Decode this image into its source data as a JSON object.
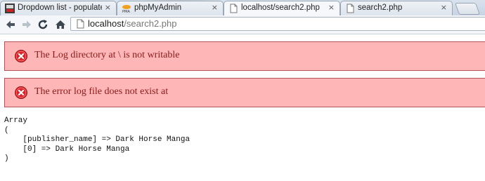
{
  "tabs": [
    {
      "label": "Dropdown list - populate",
      "favicon": "php-freaks-icon",
      "active": false
    },
    {
      "label": "phpMyAdmin",
      "favicon": "phpmyadmin-icon",
      "active": false
    },
    {
      "label": "localhost/search2.php",
      "favicon": "page-icon",
      "active": true
    },
    {
      "label": "search2.php",
      "favicon": "page-icon",
      "active": false
    }
  ],
  "tab_close_glyph": "×",
  "toolbar": {
    "url_host": "localhost",
    "url_path": "/search2.php"
  },
  "errors": [
    {
      "message": "The Log directory at \\ is not writable"
    },
    {
      "message": "The error log file does not exist at"
    }
  ],
  "output": {
    "lines": [
      "Array",
      "(",
      "    [publisher_name] => Dark Horse Manga",
      "    [0] => Dark Horse Manga",
      ")"
    ]
  },
  "colors": {
    "error_bg": "#ffb6b6",
    "error_border": "#b0555a",
    "error_text": "#8a1a1a",
    "error_icon": "#d9252b"
  }
}
